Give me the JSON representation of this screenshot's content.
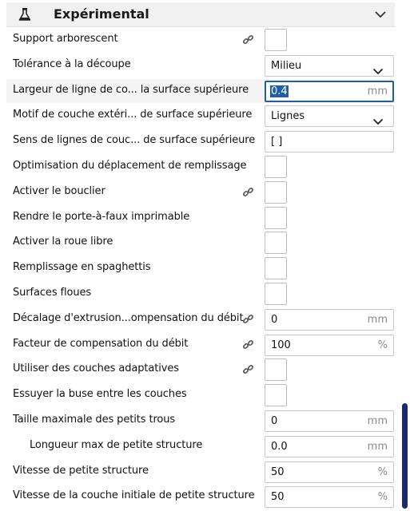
{
  "section": {
    "title": "Expérimental"
  },
  "settings": [
    {
      "label": "Support arborescent",
      "control": "checkbox",
      "link": true
    },
    {
      "label": "Tolérance à la découpe",
      "control": "dropdown",
      "value": "Milieu",
      "link": false
    },
    {
      "label": "Largeur de ligne de co... la surface supérieure",
      "control": "number",
      "value": "0.4",
      "unit": "mm",
      "link": false,
      "focused": true
    },
    {
      "label": "Motif de couche extéri... de surface supérieure",
      "control": "dropdown",
      "value": "Lignes",
      "link": false
    },
    {
      "label": "Sens de lignes de couc... de surface supérieure",
      "control": "text",
      "value": "[ ]",
      "unit": "",
      "link": false
    },
    {
      "label": "Optimisation du déplacement de remplissage",
      "control": "checkbox",
      "link": false
    },
    {
      "label": "Activer le bouclier",
      "control": "checkbox",
      "link": true
    },
    {
      "label": "Rendre le porte-à-faux imprimable",
      "control": "checkbox",
      "link": false
    },
    {
      "label": "Activer la roue libre",
      "control": "checkbox",
      "link": false
    },
    {
      "label": "Remplissage en spaghettis",
      "control": "checkbox",
      "link": false
    },
    {
      "label": "Surfaces floues",
      "control": "checkbox",
      "link": false
    },
    {
      "label": "Décalage d'extrusion...ompensation du débit",
      "control": "number",
      "value": "0",
      "unit": "mm",
      "link": true
    },
    {
      "label": "Facteur de compensation du débit",
      "control": "number",
      "value": "100",
      "unit": "%",
      "link": true
    },
    {
      "label": "Utiliser des couches adaptatives",
      "control": "checkbox",
      "link": true
    },
    {
      "label": "Essuyer la buse entre les couches",
      "control": "checkbox",
      "link": false
    },
    {
      "label": "Taille maximale des petits trous",
      "control": "number",
      "value": "0",
      "unit": "mm",
      "link": false
    },
    {
      "label": "Longueur max de petite structure",
      "control": "number",
      "value": "0.0",
      "unit": "mm",
      "link": false,
      "indent": true
    },
    {
      "label": "Vitesse de petite structure",
      "control": "number",
      "value": "50",
      "unit": "%",
      "link": false
    },
    {
      "label": "Vitesse de la couche initiale de petite structure",
      "control": "number",
      "value": "50",
      "unit": "%",
      "link": false
    }
  ],
  "icons": {
    "header": "flask-icon",
    "collapse": "chevron-down-icon",
    "link": "link-chain-icon",
    "dropdown": "chevron-down-icon"
  },
  "colors": {
    "focus": "#1f5fa6",
    "scrollbar": "#1a2a6c",
    "header_bg": "#f0f0f0"
  }
}
